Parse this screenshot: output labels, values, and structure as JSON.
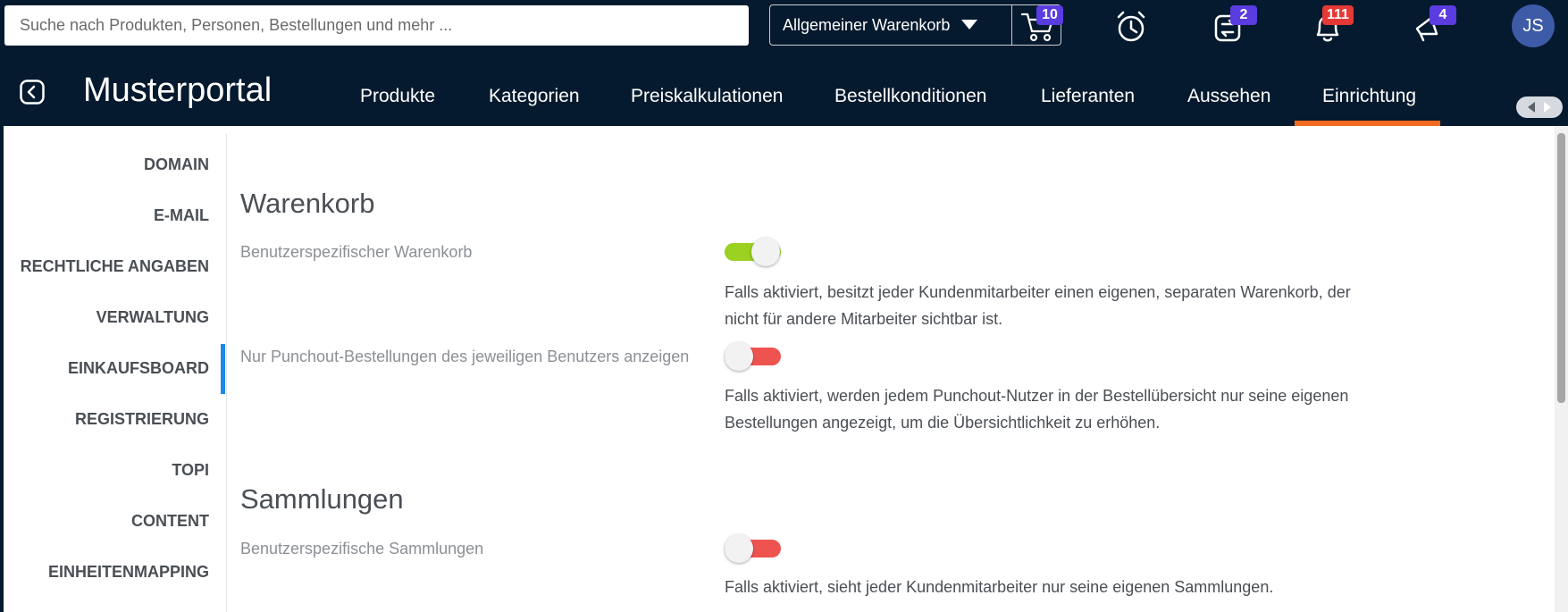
{
  "header": {
    "search_placeholder": "Suche nach Produkten, Personen, Bestellungen und mehr ...",
    "cart_selector": {
      "label": "Allgemeiner Warenkorb",
      "badge": "10"
    },
    "icons": [
      {
        "name": "alarm-clock-icon",
        "badge": ""
      },
      {
        "name": "exchange-icon",
        "badge": "2"
      },
      {
        "name": "bell-icon",
        "badge": "111"
      },
      {
        "name": "megaphone-icon",
        "badge": "4"
      }
    ],
    "avatar_initials": "JS",
    "brand": "Musterportal",
    "nav": [
      "Produkte",
      "Kategorien",
      "Preiskalkulationen",
      "Bestellkonditionen",
      "Lieferanten",
      "Aussehen",
      "Einrichtung"
    ],
    "active_nav": "Einrichtung"
  },
  "sidebar": {
    "items": [
      "DOMAIN",
      "E-MAIL",
      "RECHTLICHE ANGABEN",
      "VERWALTUNG",
      "EINKAUFSBOARD",
      "REGISTRIERUNG",
      "TOPI",
      "CONTENT",
      "EINHEITENMAPPING"
    ],
    "active": "EINKAUFSBOARD"
  },
  "sections": [
    {
      "title": "Warenkorb",
      "options": [
        {
          "label": "Benutzerspezifischer Warenkorb",
          "enabled": true,
          "description": "Falls aktiviert, besitzt jeder Kundenmitarbeiter einen eigenen, separaten Warenkorb, der nicht für andere Mitarbeiter sichtbar ist."
        },
        {
          "label": "Nur Punchout-Bestellungen des jeweiligen Benutzers anzeigen",
          "enabled": false,
          "description": "Falls aktiviert, werden jedem Punchout-Nutzer in der Bestellübersicht nur seine eigenen Bestellungen angezeigt, um die Übersichtlichkeit zu erhöhen."
        }
      ]
    },
    {
      "title": "Sammlungen",
      "options": [
        {
          "label": "Benutzerspezifische Sammlungen",
          "enabled": false,
          "description": "Falls aktiviert, sieht jeder Kundenmitarbeiter nur seine eigenen Sammlungen."
        }
      ]
    }
  ],
  "colors": {
    "header_bg": "#051a2e",
    "accent_orange": "#f06a1f",
    "active_blue": "#1e88e5",
    "toggle_on": "#9bd120",
    "toggle_off": "#ef5350",
    "badge_purple": "#5b3ce0",
    "badge_red": "#e53935"
  }
}
